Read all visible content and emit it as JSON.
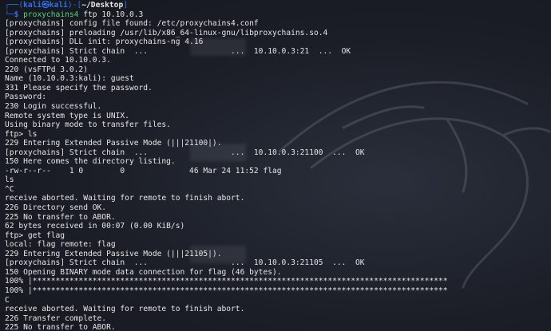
{
  "prompt": {
    "corner_top": "┌──(",
    "user": "kali㉿kali",
    "sep": ")-[",
    "path": "~/Desktop",
    "close": "]",
    "corner_bottom": "└─",
    "dollar": "$ ",
    "command": "proxychains4",
    "args": " ftp 10.10.0.3"
  },
  "output": [
    "[proxychains] config file found: /etc/proxychains4.conf",
    "[proxychains] preloading /usr/lib/x86_64-linux-gnu/libproxychains.so.4",
    "[proxychains] DLL init: proxychains-ng 4.16",
    "[proxychains] Strict chain  ...                  ...  10.10.0.3:21  ...  OK",
    "Connected to 10.10.0.3.",
    "220 (vsFTPd 3.0.2)",
    "Name (10.10.0.3:kali): guest",
    "331 Please specify the password.",
    "Password:",
    "230 Login successful.",
    "Remote system type is UNIX.",
    "Using binary mode to transfer files.",
    "ftp> ls",
    "229 Entering Extended Passive Mode (|||21100|).",
    "[proxychains] Strict chain  ...                  ...  10.10.0.3:21100  ...  OK",
    "150 Here comes the directory listing.",
    "-rw-r--r--    1 0        0              46 Mar 24 11:52 flag",
    "ls",
    "^C",
    "receive aborted. Waiting for remote to finish abort.",
    "226 Directory send OK.",
    "225 No transfer to ABOR.",
    "62 bytes received in 00:07 (0.00 KiB/s)",
    "ftp> get flag",
    "local: flag remote: flag",
    "229 Entering Extended Passive Mode (|||21105|).",
    "[proxychains] Strict chain  ...                  ...  10.10.0.3:21105  ...  OK",
    "150 Opening BINARY mode data connection for flag (46 bytes).",
    "100% |******************************************************************************************",
    "100% |******************************************************************************************",
    "C",
    "receive aborted. Waiting for remote to finish abort.",
    "226 Transfer complete.",
    "225 No transfer to ABOR."
  ]
}
